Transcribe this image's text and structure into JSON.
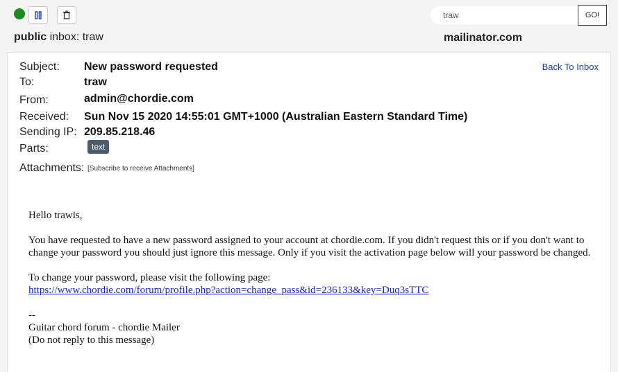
{
  "topbar": {
    "status_color": "#1f8a1f",
    "inbox_visibility": "public",
    "inbox_word": "inbox:",
    "inbox_name": "traw",
    "search_value": "traw",
    "go_label": "GO!",
    "domain": "mailinator.com"
  },
  "message": {
    "back_link": "Back To Inbox",
    "headers": {
      "subject_label": "Subject:",
      "subject": "New password requested",
      "to_label": "To:",
      "to": "traw",
      "from_label": "From:",
      "from": "admin@chordie.com",
      "received_label": "Received:",
      "received": "Sun Nov 15 2020 14:55:01 GMT+1000 (Australian Eastern Standard Time)",
      "ip_label": "Sending IP:",
      "ip": "209.85.218.46",
      "parts_label": "Parts:",
      "parts_badge": "text",
      "attachments_label": "Attachments:",
      "attachments_note": "[Subscribe to receive Attachments]"
    },
    "body": {
      "greeting": "Hello trawis,",
      "para1": "You have requested to have a new password assigned to your account at chordie.com. If you didn't request this or if you don't want to change your password you should just ignore this message. Only if you visit the activation page below will your password be changed.",
      "para2": "To change your password, please visit the following page:",
      "link": "https://www.chordie.com/forum/profile.php?action=change_pass&id=236133&key=Duq3sTTC",
      "sig_dash": "--",
      "sig_line": "Guitar chord forum - chordie Mailer",
      "sig_note": "(Do not reply to this message)"
    }
  }
}
